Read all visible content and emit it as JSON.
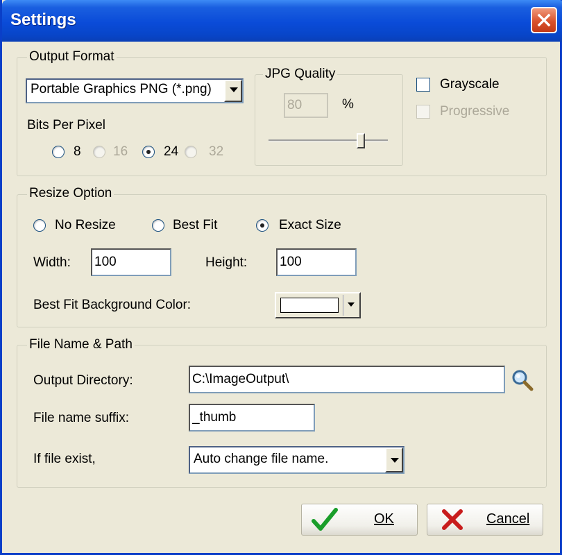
{
  "window": {
    "title": "Settings",
    "close_label": "×"
  },
  "output_format": {
    "group_label": "Output Format",
    "format_selected": "Portable Graphics PNG (*.png)",
    "bpp_label": "Bits Per Pixel",
    "bpp_options": [
      {
        "label": "8",
        "enabled": true,
        "selected": false
      },
      {
        "label": "16",
        "enabled": false,
        "selected": false
      },
      {
        "label": "24",
        "enabled": true,
        "selected": true
      },
      {
        "label": "32",
        "enabled": false,
        "selected": false
      }
    ]
  },
  "jpg_quality": {
    "group_label": "JPG Quality",
    "value": "80",
    "unit": "%",
    "slider_level": 0.8
  },
  "options": {
    "grayscale_label": "Grayscale",
    "grayscale_checked": false,
    "progressive_label": "Progressive",
    "progressive_enabled": false
  },
  "resize": {
    "group_label": "Resize Option",
    "options": [
      {
        "label": "No Resize",
        "selected": false
      },
      {
        "label": "Best Fit",
        "selected": false
      },
      {
        "label": "Exact Size",
        "selected": true
      }
    ],
    "width_label": "Width:",
    "width_value": "100",
    "height_label": "Height:",
    "height_value": "100",
    "bg_color_label": "Best Fit Background Color:",
    "bg_color": "#ffffff"
  },
  "file": {
    "group_label": "File Name & Path",
    "output_dir_label": "Output Directory:",
    "output_dir_value": "C:\\ImageOutput\\",
    "suffix_label": "File name suffix:",
    "suffix_value": "_thumb",
    "exist_label": "If file exist,",
    "exist_selected": "Auto change file name."
  },
  "buttons": {
    "ok_label": "OK",
    "cancel_label": "Cancel"
  },
  "icons": {
    "browse": "magnifier-icon",
    "ok": "checkmark-icon",
    "cancel": "x-icon",
    "close": "close-icon"
  },
  "colors": {
    "titlebar": "#0a4bd8",
    "dialog_bg": "#ece9d8",
    "ok_check": "#1a9e2a",
    "cancel_x": "#c81c1c"
  }
}
